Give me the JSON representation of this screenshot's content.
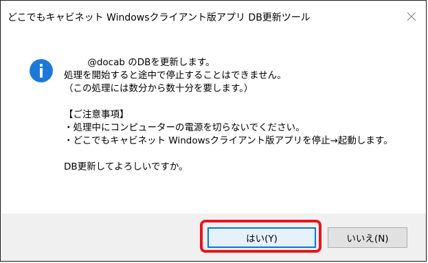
{
  "window": {
    "title": "どこでもキャビネット Windowsクライアント版アプリ DB更新ツール",
    "close_icon": "close-icon"
  },
  "message": {
    "icon": "info-icon",
    "lines": [
      "        @docab のDBを更新します。",
      "処理を開始すると途中で停止することはできません。",
      "（この処理には数分から数十分を要します。）",
      "",
      "【ご注意事項】",
      "・処理中にコンピューターの電源を切らないでください。",
      "・どこでもキャビネット Windowsクライアント版アプリを停止→起動します。",
      "",
      "DB更新してよろしいですか。"
    ]
  },
  "buttons": {
    "yes_label": "はい(Y)",
    "no_label": "いいえ(N)"
  },
  "colors": {
    "info_icon": "#1e78d7",
    "highlight": "#e8141e",
    "footer_bg": "#f0f0f0",
    "default_button_border": "#0078d7"
  }
}
